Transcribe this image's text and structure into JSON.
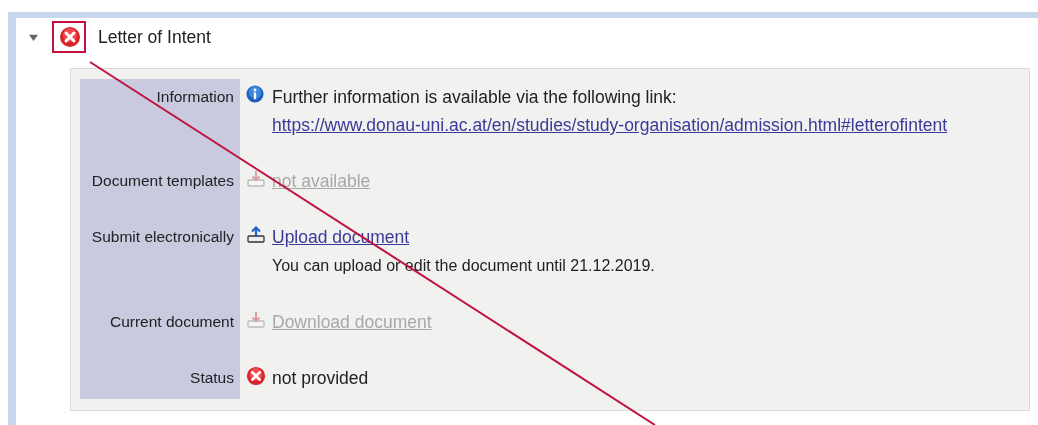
{
  "section": {
    "title": "Letter of Intent",
    "expanded": true,
    "kind": "error"
  },
  "rows": [
    {
      "label": "Information",
      "kind": "info",
      "lines": [
        {
          "kind": "text",
          "text": "Further information is available via the following link:"
        },
        {
          "kind": "link",
          "text": "https://www.donau-uni.ac.at/en/studies/study-organisation/admission.html#letterofintent",
          "disabled": false
        }
      ]
    },
    {
      "label": "Document templates",
      "kind": "download",
      "lines": [
        {
          "kind": "link",
          "text": "not available",
          "disabled": true
        }
      ]
    },
    {
      "label": "Submit electronically",
      "kind": "upload",
      "lines": [
        {
          "kind": "link",
          "text": "Upload document",
          "disabled": false
        },
        {
          "kind": "note",
          "text": "You can upload or edit the document until 21.12.2019."
        }
      ]
    },
    {
      "label": "Current document",
      "kind": "download",
      "lines": [
        {
          "kind": "link",
          "text": "Download document",
          "disabled": true
        }
      ]
    },
    {
      "label": "Status",
      "kind": "error",
      "lines": [
        {
          "kind": "status",
          "text": "not provided"
        }
      ]
    }
  ],
  "annotation": {
    "kind": "callout"
  }
}
